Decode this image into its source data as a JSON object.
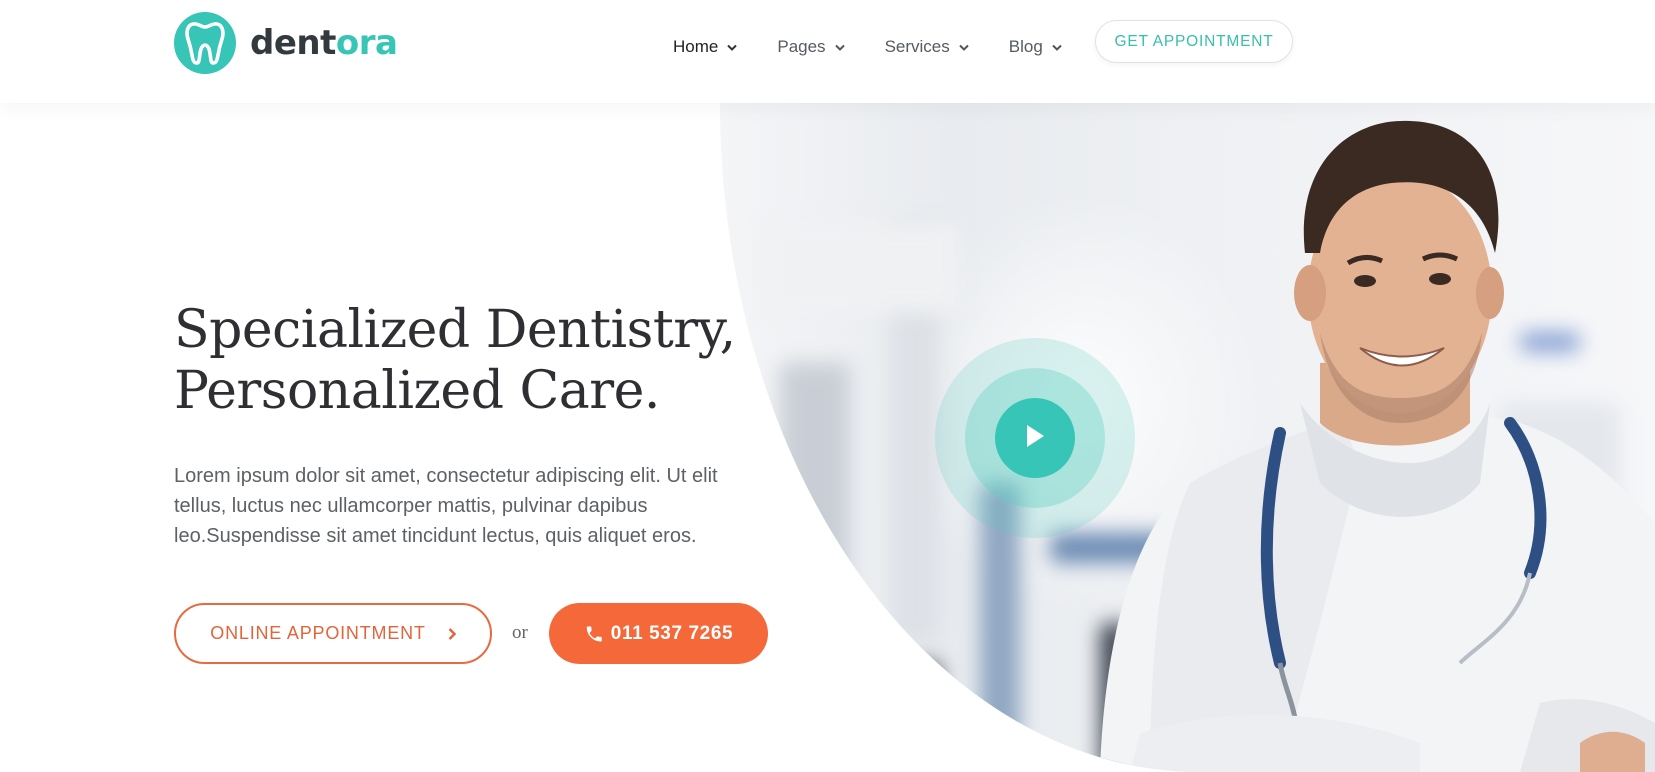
{
  "brand": {
    "name_part1": "dent",
    "name_part2": "ora",
    "accent_color": "#36c5b6",
    "logo_icon": "tooth-icon"
  },
  "nav": {
    "items": [
      {
        "label": "Home",
        "active": true,
        "icon": "chevron-down-icon"
      },
      {
        "label": "Pages",
        "active": false,
        "icon": "chevron-down-icon"
      },
      {
        "label": "Services",
        "active": false,
        "icon": "chevron-down-icon"
      },
      {
        "label": "Blog",
        "active": false,
        "icon": "chevron-down-icon"
      }
    ],
    "cta_label": "GET APPOINTMENT"
  },
  "hero": {
    "title_line1": "Specialized Dentistry,",
    "title_line2": "Personalized Care.",
    "description": "Lorem ipsum dolor sit amet, consectetur adipiscing elit. Ut elit tellus, luctus nec ullamcorper mattis, pulvinar dapibus leo.Suspendisse sit amet tincidunt lectus, quis aliquet eros.",
    "online_button_label": "ONLINE APPOINTMENT",
    "or_text": "or",
    "phone_label": "011 537 7265",
    "phone_color": "#f5683a",
    "play_icon": "play-icon"
  }
}
